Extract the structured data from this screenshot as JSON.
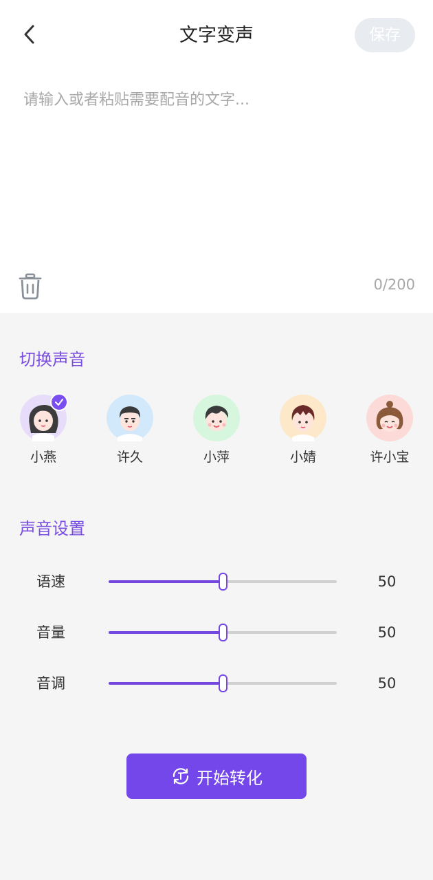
{
  "header": {
    "title": "文字变声",
    "save_label": "保存"
  },
  "editor": {
    "placeholder": "请输入或者粘贴需要配音的文字...",
    "value": "",
    "counter": "0/200"
  },
  "voices_section": {
    "title": "切换声音",
    "selected_index": 0,
    "voices": [
      {
        "name": "小燕",
        "bg": "#e7dcf9",
        "selected": true
      },
      {
        "name": "许久",
        "bg": "#d2e9fb",
        "selected": false
      },
      {
        "name": "小萍",
        "bg": "#d6f6dd",
        "selected": false
      },
      {
        "name": "小婧",
        "bg": "#fde8c9",
        "selected": false
      },
      {
        "name": "许小宝",
        "bg": "#fbdad8",
        "selected": false
      }
    ]
  },
  "settings_section": {
    "title": "声音设置",
    "sliders": [
      {
        "label": "语速",
        "value": "50",
        "fraction": 0.5
      },
      {
        "label": "音量",
        "value": "50",
        "fraction": 0.5
      },
      {
        "label": "音调",
        "value": "50",
        "fraction": 0.5
      }
    ]
  },
  "actions": {
    "convert_label": "开始转化"
  },
  "colors": {
    "accent": "#7447e0",
    "check_badge": "#7b4ef0",
    "save_disabled_bg": "#e8ebef"
  }
}
